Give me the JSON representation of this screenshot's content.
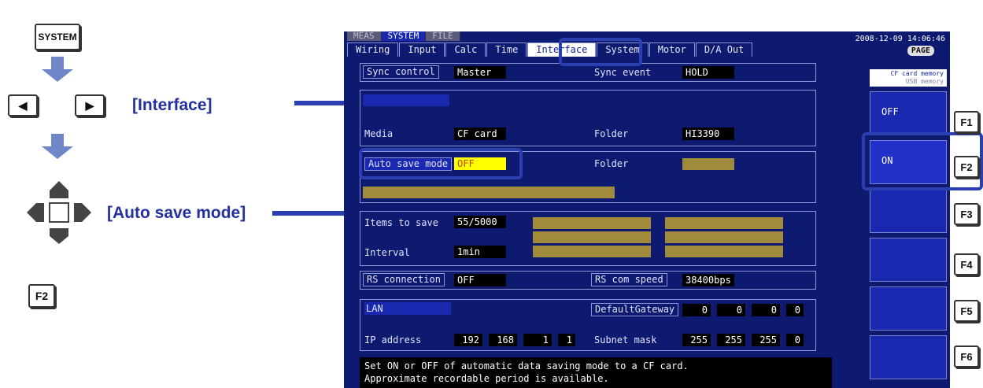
{
  "left": {
    "system_key": "SYSTEM",
    "interface_callout": "[Interface]",
    "auto_save_callout": "[Auto save mode]",
    "f2_key": "F2",
    "left_arrow_glyph": "◀",
    "right_arrow_glyph": "▶"
  },
  "screen": {
    "mode_tabs": [
      "MEAS",
      "SYSTEM",
      "FILE"
    ],
    "datetime": "2008-12-09 14:06:46",
    "page_key": "PAGE",
    "tabs": [
      "Wiring",
      "Input",
      "Calc",
      "Time",
      "Interface",
      "System",
      "Motor",
      "D/A Out"
    ],
    "sync_control": {
      "label": "Sync control",
      "value": "Master"
    },
    "sync_event": {
      "label": "Sync event",
      "value": "HOLD"
    },
    "media": {
      "label": "Media",
      "value": "CF card"
    },
    "media_folder": {
      "label": "Folder",
      "value": "HI3390"
    },
    "auto_save_mode": {
      "label": "Auto save mode",
      "value": "OFF"
    },
    "auto_save_folder": {
      "label": "Folder",
      "value": ""
    },
    "items_to_save": {
      "label": "Items to save",
      "value": "55/5000"
    },
    "interval": {
      "label": "Interval",
      "value": "1min"
    },
    "rs_connection": {
      "label": "RS connection",
      "value": "OFF"
    },
    "rs_speed": {
      "label": "RS com speed",
      "value": "38400bps"
    },
    "lan": {
      "label": "LAN"
    },
    "default_gateway": {
      "label": "DefaultGateway",
      "octets": [
        "0",
        "0",
        "0",
        "0"
      ]
    },
    "ip_address": {
      "label": "IP address",
      "octets": [
        "192",
        "168",
        "1",
        "1"
      ]
    },
    "subnet_mask": {
      "label": "Subnet mask",
      "octets": [
        "255",
        "255",
        "255",
        "0"
      ]
    },
    "help_line1": "Set ON or OFF of automatic data saving mode to a CF card.",
    "help_line2": "Approximate recordable period is available."
  },
  "fn": {
    "title_line1": "CF card memory",
    "title_line2": "USB memory",
    "btn1": "OFF",
    "btn2": "ON",
    "keys": [
      "F1",
      "F2",
      "F3",
      "F4",
      "F5",
      "F6"
    ]
  },
  "colors": {
    "screen_bg": "#0d1a70",
    "highlight_blue": "#2b3fb0",
    "active_value": "#ffff00",
    "arrow_blue": "#6f87c8"
  }
}
